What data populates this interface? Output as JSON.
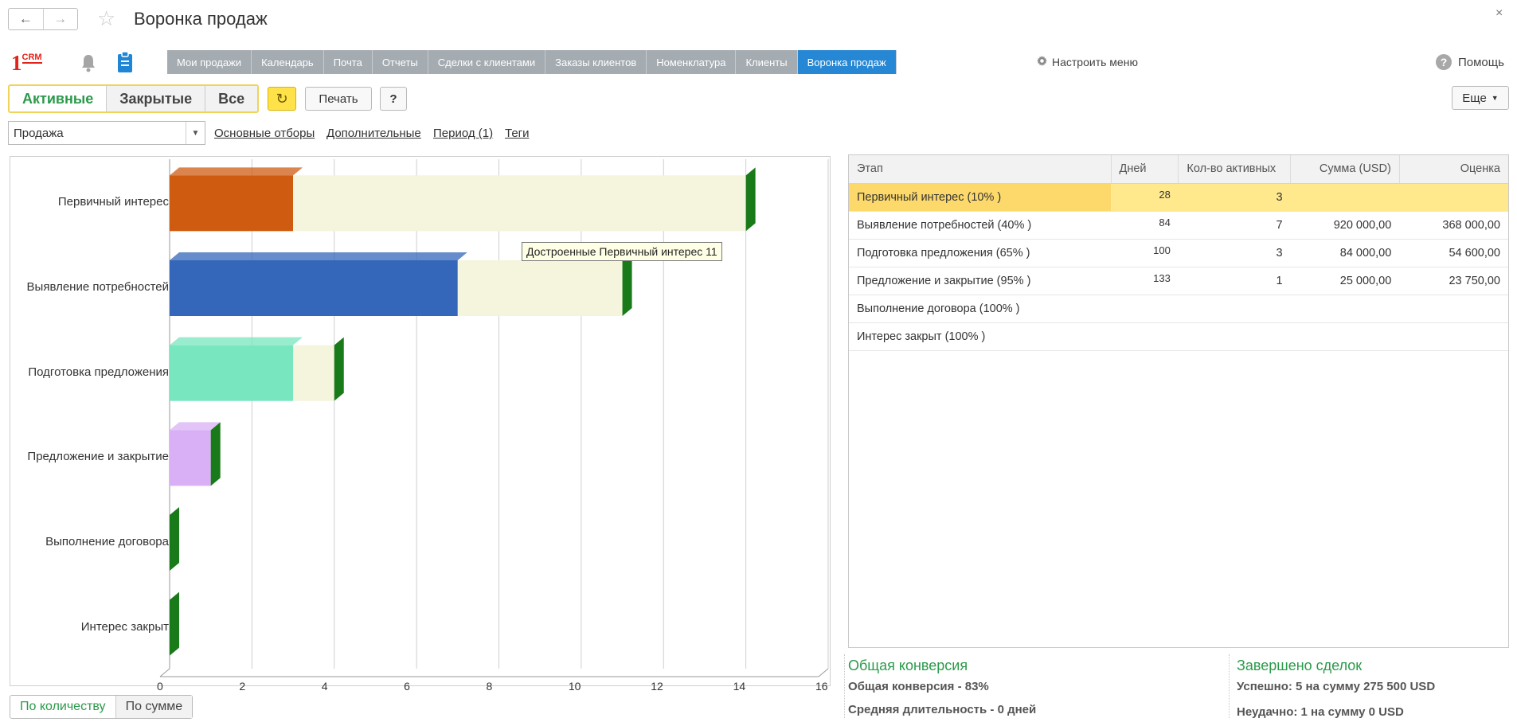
{
  "window": {
    "title": "Воронка продаж",
    "close": "×"
  },
  "logo": {
    "one": "1",
    "crm": "CRM"
  },
  "tabs": [
    "Мои продажи",
    "Календарь",
    "Почта",
    "Отчеты",
    "Сделки с клиентами",
    "Заказы клиентов",
    "Номенклатура",
    "Клиенты",
    "Воронка продаж"
  ],
  "active_tab": 8,
  "settings_label": "Настроить меню",
  "help_label": "Помощь",
  "state_toggle": [
    "Активные",
    "Закрытые",
    "Все"
  ],
  "print_label": "Печать",
  "question_label": "?",
  "more_label": "Еще",
  "filter": {
    "combo_value": "Продажа",
    "links": [
      "Основные отборы",
      "Дополнительные",
      "Период (1)",
      "Теги"
    ]
  },
  "tooltip": "Достроенные Первичный интерес 11",
  "chart_data": {
    "type": "bar",
    "orientation": "horizontal",
    "stacked": true,
    "categories": [
      "Первичный интерес",
      "Выявление потребностей",
      "Подготовка предложения",
      "Предложение и закрытие",
      "Выполнение договора",
      "Интерес закрыт"
    ],
    "series": [
      {
        "name": "",
        "values": [
          3,
          7,
          3,
          1,
          0,
          0
        ],
        "colors": [
          "#cf5b11",
          "#3466b9",
          "#78e6be",
          "#d9b0f5",
          "#ffffff",
          "#ffffff"
        ]
      },
      {
        "name": "Достроенные",
        "values": [
          11,
          4,
          1,
          0,
          0,
          0
        ],
        "color": "#f5f4dc"
      }
    ],
    "xlim": [
      0,
      16
    ],
    "xticks": [
      0,
      2,
      4,
      6,
      8,
      10,
      12,
      14,
      16
    ],
    "grid": true
  },
  "table": {
    "headers": [
      "Этап",
      "Дней",
      "Кол-во активных",
      "Сумма (USD)",
      "Оценка"
    ],
    "rows": [
      [
        "Первичный интерес (10% )",
        "28",
        "3",
        "",
        ""
      ],
      [
        "Выявление потребностей (40% )",
        "84",
        "7",
        "920 000,00",
        "368 000,00"
      ],
      [
        "Подготовка предложения (65% )",
        "100",
        "3",
        "84 000,00",
        "54 600,00"
      ],
      [
        "Предложение и закрытие (95% )",
        "133",
        "1",
        "25 000,00",
        "23 750,00"
      ],
      [
        "Выполнение договора (100% )",
        "",
        "",
        "",
        ""
      ],
      [
        "Интерес закрыт (100% )",
        "",
        "",
        "",
        ""
      ]
    ],
    "selected_row": 0
  },
  "summary": {
    "conversion_title": "Общая конверсия",
    "conversion_line": "Общая конверсия - 83%",
    "duration_line": "Средняя длительность - 0 дней",
    "completed_title": "Завершено сделок",
    "success_line": "Успешно: 5 на сумму 275 500 USD",
    "fail_line": "Неудачно: 1 на сумму 0 USD"
  },
  "bottom_toggle": [
    "По количеству",
    "По сумме"
  ]
}
